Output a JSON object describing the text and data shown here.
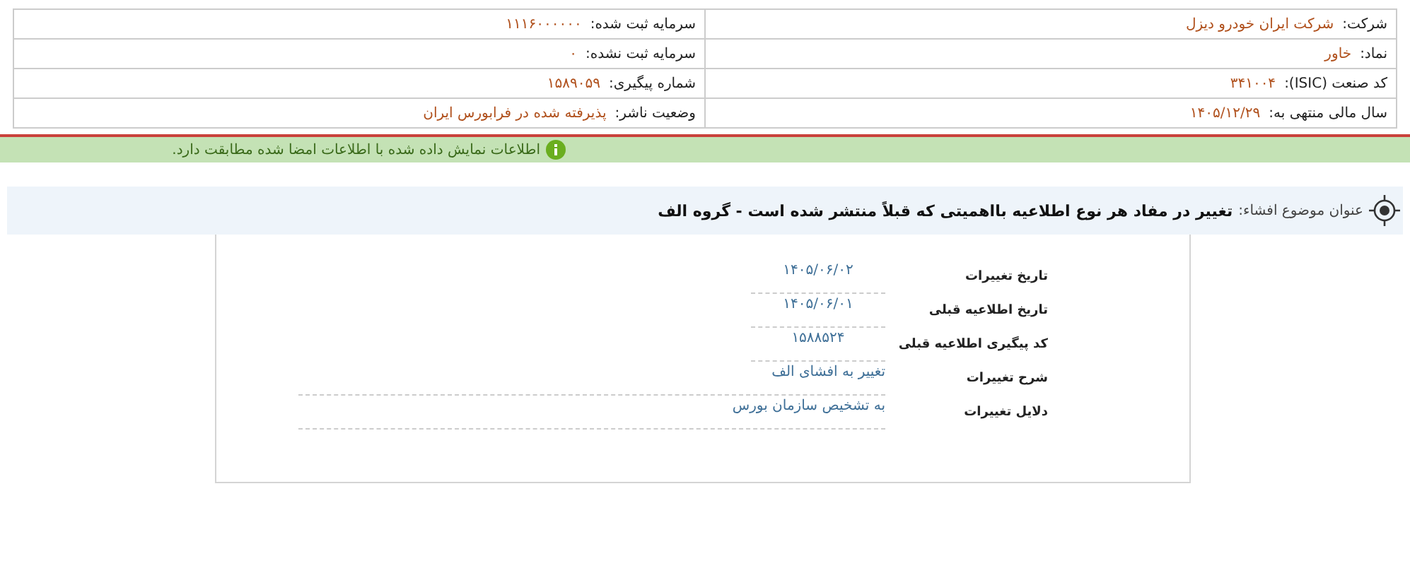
{
  "company_info": {
    "rows": [
      {
        "right": {
          "label": "شرکت:",
          "value": "شرکت ایران خودرو دیزل"
        },
        "left": {
          "label": "سرمایه ثبت شده:",
          "value": "۱۱۱۶۰۰۰۰۰۰"
        }
      },
      {
        "right": {
          "label": "نماد:",
          "value": "خاور"
        },
        "left": {
          "label": "سرمایه ثبت نشده:",
          "value": "۰"
        }
      },
      {
        "right": {
          "label": "کد صنعت (ISIC):",
          "value": "۳۴۱۰۰۴"
        },
        "left": {
          "label": "شماره پیگیری:",
          "value": "۱۵۸۹۰۵۹"
        }
      },
      {
        "right": {
          "label": "سال مالی منتهی به:",
          "value": "۱۴۰۵/۱۲/۲۹"
        },
        "left": {
          "label": "وضعیت ناشر:",
          "value": "پذیرفته شده در فرابورس ایران"
        }
      }
    ]
  },
  "notice": {
    "text": "اطلاعات نمایش داده شده با اطلاعات امضا شده مطابقت دارد."
  },
  "subject": {
    "label": "عنوان موضوع افشاء:",
    "title": "تغییر در مفاد هر نوع اطلاعیه بااهمیتی که قبلاً منتشر شده است - گروه الف"
  },
  "details": [
    {
      "kind": "short",
      "label": "تاریخ تغییرات",
      "value": "۱۴۰۵/۰۶/۰۲"
    },
    {
      "kind": "short",
      "label": "تاریخ اطلاعیه قبلی",
      "value": "۱۴۰۵/۰۶/۰۱"
    },
    {
      "kind": "short",
      "label": "کد پیگیری اطلاعیه قبلی",
      "value": "۱۵۸۸۵۲۴"
    },
    {
      "kind": "long",
      "label": "شرح تغییرات",
      "value": "تغییر به افشای الف"
    },
    {
      "kind": "long",
      "label": "دلایل تغییرات",
      "value": "به تشخیص سازمان بورس"
    }
  ]
}
